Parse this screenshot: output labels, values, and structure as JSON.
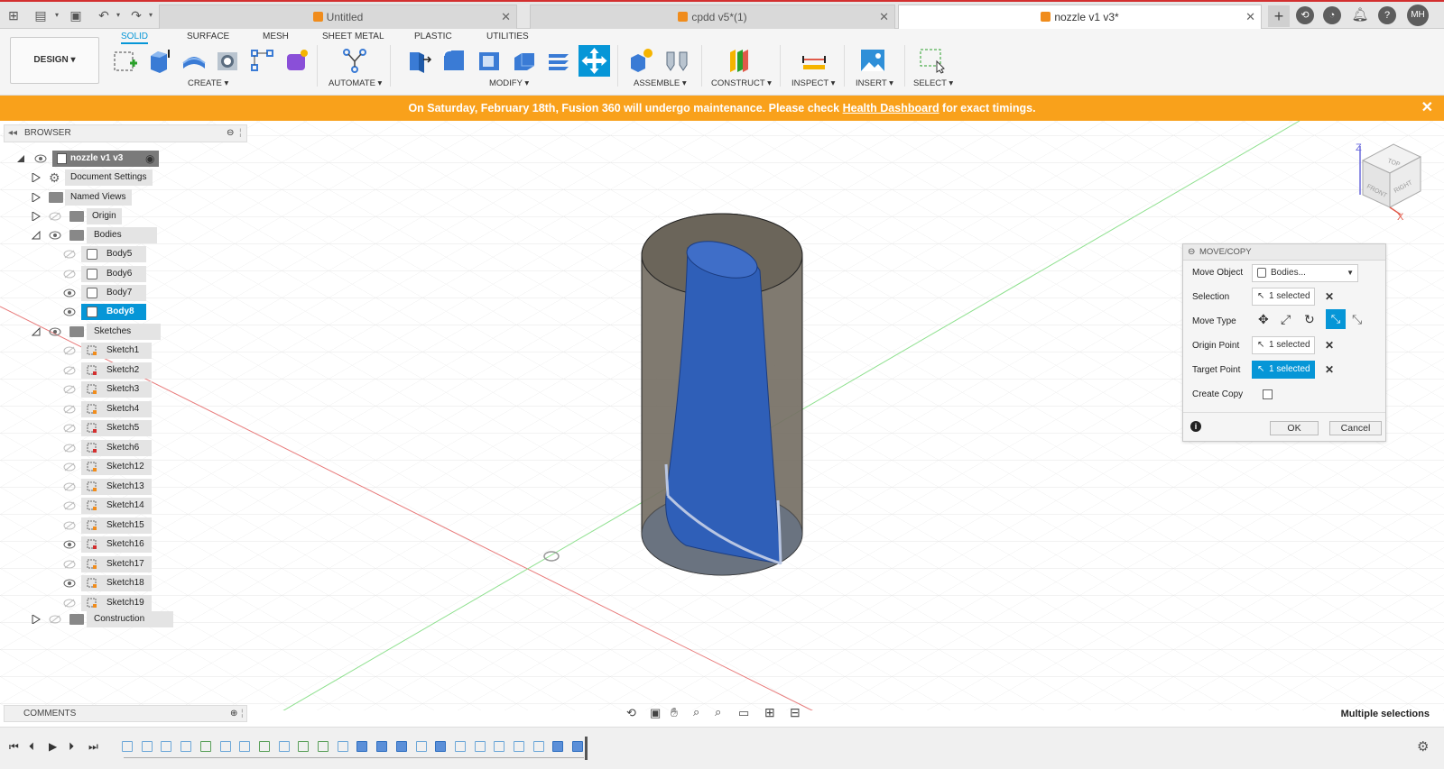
{
  "titlebar": {
    "tabs": [
      {
        "label": "Untitled"
      },
      {
        "label": "cpdd v5*(1)"
      },
      {
        "label": "nozzle v1 v3*"
      }
    ],
    "user_initials": "MH"
  },
  "toolbar": {
    "workspace": "DESIGN ▾",
    "tabs": [
      "SOLID",
      "SURFACE",
      "MESH",
      "SHEET METAL",
      "PLASTIC",
      "UTILITIES"
    ],
    "active_tab": "SOLID",
    "groups": [
      "CREATE ▾",
      "AUTOMATE ▾",
      "MODIFY ▾",
      "ASSEMBLE ▾",
      "CONSTRUCT ▾",
      "INSPECT ▾",
      "INSERT ▾",
      "SELECT ▾"
    ]
  },
  "banner": {
    "text_before": "On Saturday, February 18th, Fusion 360 will undergo maintenance. Please check ",
    "link": "Health Dashboard",
    "text_after": " for exact timings.",
    "close": "✕"
  },
  "browser": {
    "title": "BROWSER",
    "root": "nozzle v1 v3",
    "items": {
      "document_settings": "Document Settings",
      "named_views": "Named Views",
      "origin": "Origin",
      "bodies": "Bodies",
      "sketches": "Sketches",
      "construction": "Construction"
    },
    "bodies": [
      "Body5",
      "Body6",
      "Body7",
      "Body8"
    ],
    "selected_body": "Body8",
    "sketches": [
      "Sketch1",
      "Sketch2",
      "Sketch3",
      "Sketch4",
      "Sketch5",
      "Sketch6",
      "Sketch12",
      "Sketch13",
      "Sketch14",
      "Sketch15",
      "Sketch16",
      "Sketch17",
      "Sketch18",
      "Sketch19"
    ]
  },
  "move_copy": {
    "title": "MOVE/COPY",
    "rows": {
      "move_object": "Move Object",
      "move_object_value": "Bodies...",
      "selection": "Selection",
      "selection_value": "1 selected",
      "move_type": "Move Type",
      "origin_point": "Origin Point",
      "origin_value": "1 selected",
      "target_point": "Target Point",
      "target_value": "1 selected",
      "create_copy": "Create Copy"
    },
    "ok": "OK",
    "cancel": "Cancel"
  },
  "viewcube": {
    "z": "Z",
    "x": "X",
    "top": "TOP",
    "front": "FRONT",
    "right": "RIGHT"
  },
  "comments": {
    "title": "COMMENTS"
  },
  "status": {
    "text": "Multiple selections"
  },
  "colors": {
    "accent": "#0696d7",
    "banner": "#f9a11b",
    "body_blue": "#2f5fb8",
    "cylinder": "#7a7469",
    "brand_cube": "#f08c1c"
  }
}
